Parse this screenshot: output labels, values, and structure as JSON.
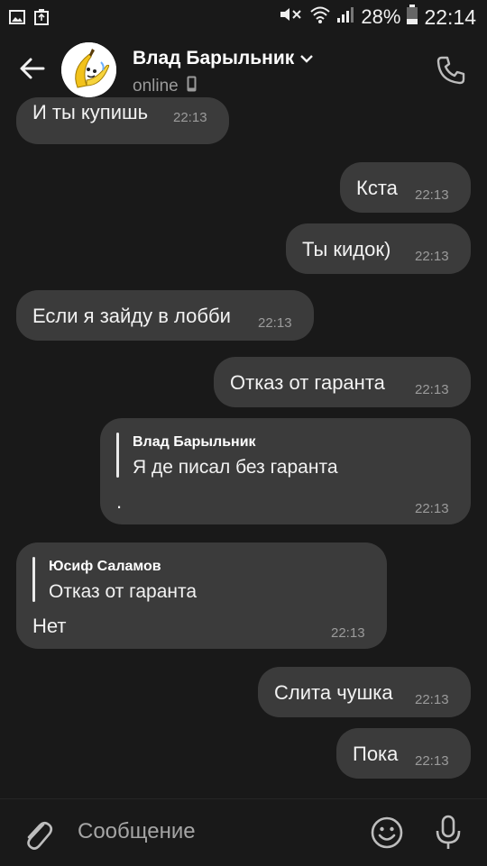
{
  "status_bar": {
    "battery_percent": "28%",
    "time": "22:14"
  },
  "header": {
    "contact_name": "Влад Барыльник",
    "status": "online"
  },
  "messages": [
    {
      "direction": "in",
      "text": "И ты купишь",
      "time": "22:13"
    },
    {
      "direction": "out",
      "text": "Кста",
      "time": "22:13"
    },
    {
      "direction": "out",
      "text": "Ты кидок)",
      "time": "22:13"
    },
    {
      "direction": "in",
      "text": "Если я зайду в лобби",
      "time": "22:13"
    },
    {
      "direction": "out",
      "text": "Отказ от гаранта",
      "time": "22:13"
    },
    {
      "direction": "out",
      "reply_author": "Влад Барыльник",
      "reply_text": "Я де писал без гаранта",
      "text": ".",
      "time": "22:13"
    },
    {
      "direction": "in",
      "reply_author": "Юсиф Саламов",
      "reply_text": "Отказ от гаранта",
      "text": "Нет",
      "time": "22:13"
    },
    {
      "direction": "out",
      "text": "Слита чушка",
      "time": "22:13"
    },
    {
      "direction": "out",
      "text": "Пока",
      "time": "22:13"
    }
  ],
  "composer": {
    "placeholder": "Сообщение"
  },
  "colors": {
    "background": "#191919",
    "bubble": "#3b3b3b",
    "timestamp": "#9b9b9b"
  },
  "icons": [
    "image-icon",
    "recycle-icon",
    "mute-icon",
    "wifi-icon",
    "signal-icon",
    "battery-icon",
    "back-arrow-icon",
    "avatar-banana",
    "chevron-down-icon",
    "phone-icon",
    "mobile-icon",
    "attach-icon",
    "emoji-icon",
    "mic-icon"
  ]
}
